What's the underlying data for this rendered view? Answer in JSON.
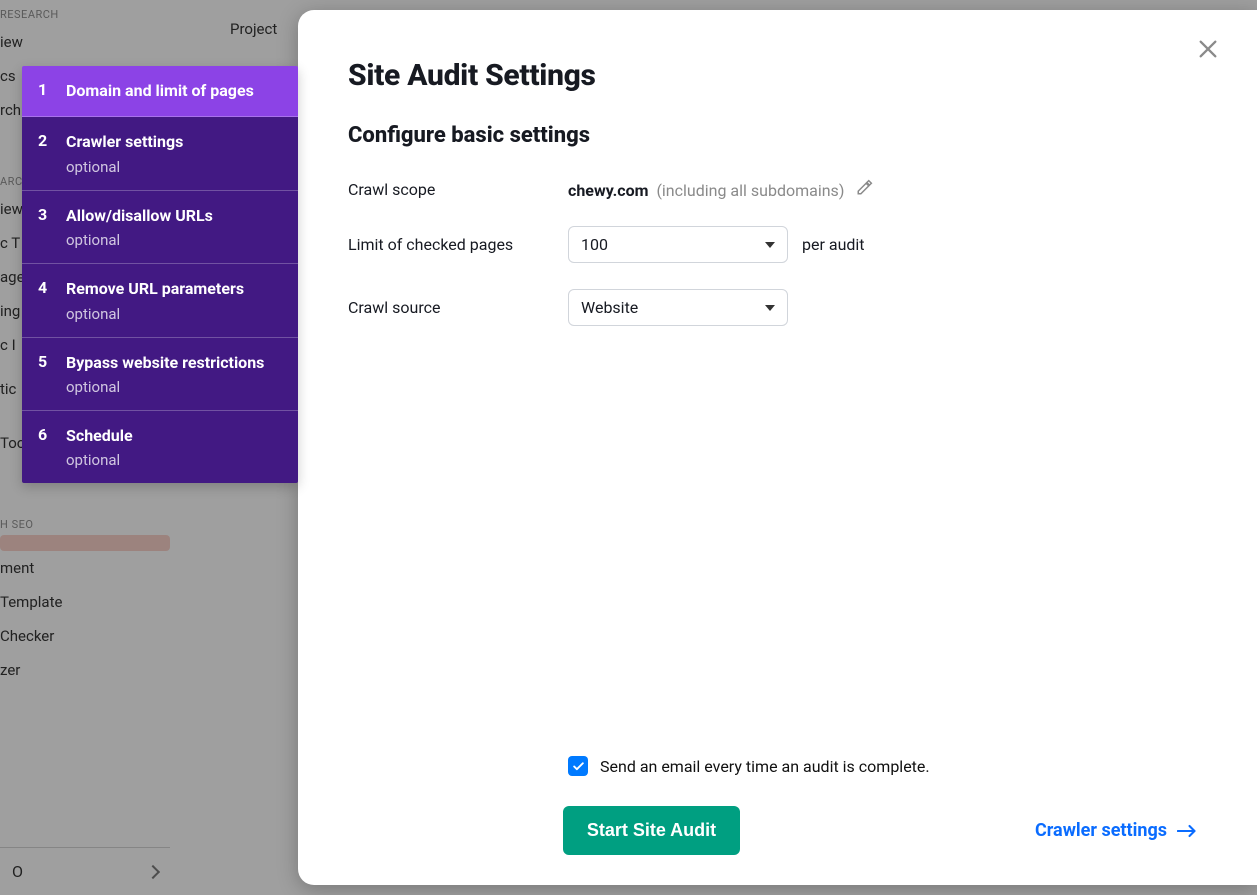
{
  "bg": {
    "section1": "RESEARCH",
    "items1": [
      "iew",
      "cs",
      "rch"
    ],
    "section2": "ARCH",
    "items2": [
      "iew",
      "c T",
      "age",
      "ing",
      "c I",
      "tic",
      "Tool"
    ],
    "section3": "H SEO",
    "items3": [
      "",
      "ment",
      "Template",
      "Checker",
      "zer"
    ],
    "bottom": "O",
    "tabs": "Project"
  },
  "wizard": {
    "steps": [
      {
        "n": "1",
        "label": "Domain and limit of pages",
        "sub": ""
      },
      {
        "n": "2",
        "label": "Crawler settings",
        "sub": "optional"
      },
      {
        "n": "3",
        "label": "Allow/disallow URLs",
        "sub": "optional"
      },
      {
        "n": "4",
        "label": "Remove URL parameters",
        "sub": "optional"
      },
      {
        "n": "5",
        "label": "Bypass website restrictions",
        "sub": "optional"
      },
      {
        "n": "6",
        "label": "Schedule",
        "sub": "optional"
      }
    ]
  },
  "modal": {
    "title": "Site Audit Settings",
    "subtitle": "Configure basic settings",
    "scope_label": "Crawl scope",
    "scope_value": "chewy.com",
    "scope_note": "(including all subdomains)",
    "limit_label": "Limit of checked pages",
    "limit_value": "100",
    "limit_suffix": "per audit",
    "source_label": "Crawl source",
    "source_value": "Website",
    "email_label": "Send an email every time an audit is complete.",
    "start_button": "Start Site Audit",
    "next_link": "Crawler settings"
  }
}
